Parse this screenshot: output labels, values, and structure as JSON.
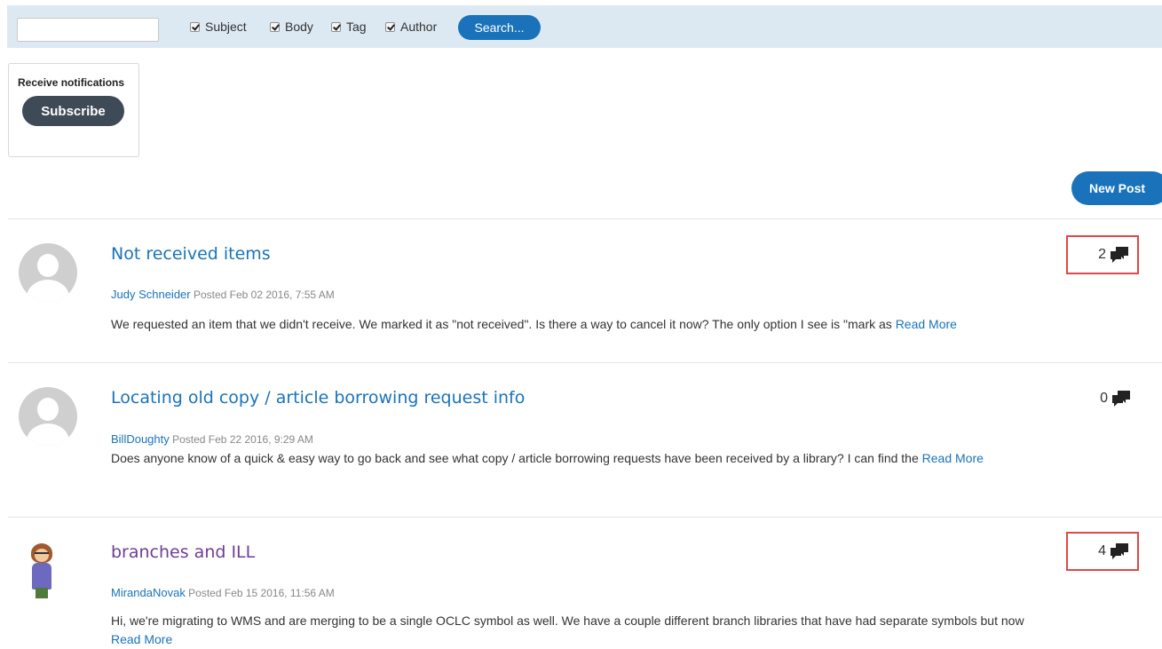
{
  "search": {
    "value": "",
    "options": [
      {
        "label": "Subject",
        "checked": true
      },
      {
        "label": "Body",
        "checked": true
      },
      {
        "label": "Tag",
        "checked": true
      },
      {
        "label": "Author",
        "checked": true
      }
    ],
    "button_label": "Search..."
  },
  "notifications": {
    "label": "Receive notifications",
    "subscribe_label": "Subscribe"
  },
  "new_post_label": "New Post",
  "posts": [
    {
      "title": "Not received items",
      "author": "Judy Schneider",
      "posted": "Posted Feb 02 2016, 7:55 AM",
      "excerpt": "We requested an item that we didn't receive. We marked it as \"not received\". Is there a way to cancel it now? The only option I see is \"mark as ",
      "read_more": "Read More",
      "reply_count": "2",
      "avatar": "default-user-icon"
    },
    {
      "title": "Locating old copy / article borrowing request info",
      "author": "BillDoughty",
      "posted": "Posted Feb 22 2016, 9:29 AM",
      "excerpt": "Does anyone know of a quick & easy way to go back and see what copy / article borrowing requests have been received by a library?  I can find the ",
      "read_more": "Read More",
      "reply_count": "0",
      "avatar": "default-user-icon"
    },
    {
      "title": "branches and ILL",
      "author": "MirandaNovak",
      "posted": "Posted Feb 15 2016, 11:56 AM",
      "excerpt": "Hi, we're migrating to WMS and are merging to be a single OCLC symbol as well. We have a couple different branch libraries that have had separate symbols but now ",
      "read_more": "Read More",
      "reply_count": "4",
      "avatar": "cartoon-user-avatar"
    }
  ],
  "colors": {
    "link": "#1a73ba",
    "visited_link": "#6e3d96",
    "search_bar_bg": "#dde9f2",
    "highlight_border": "#e04848",
    "subscribe_bg": "#3e4a55"
  }
}
